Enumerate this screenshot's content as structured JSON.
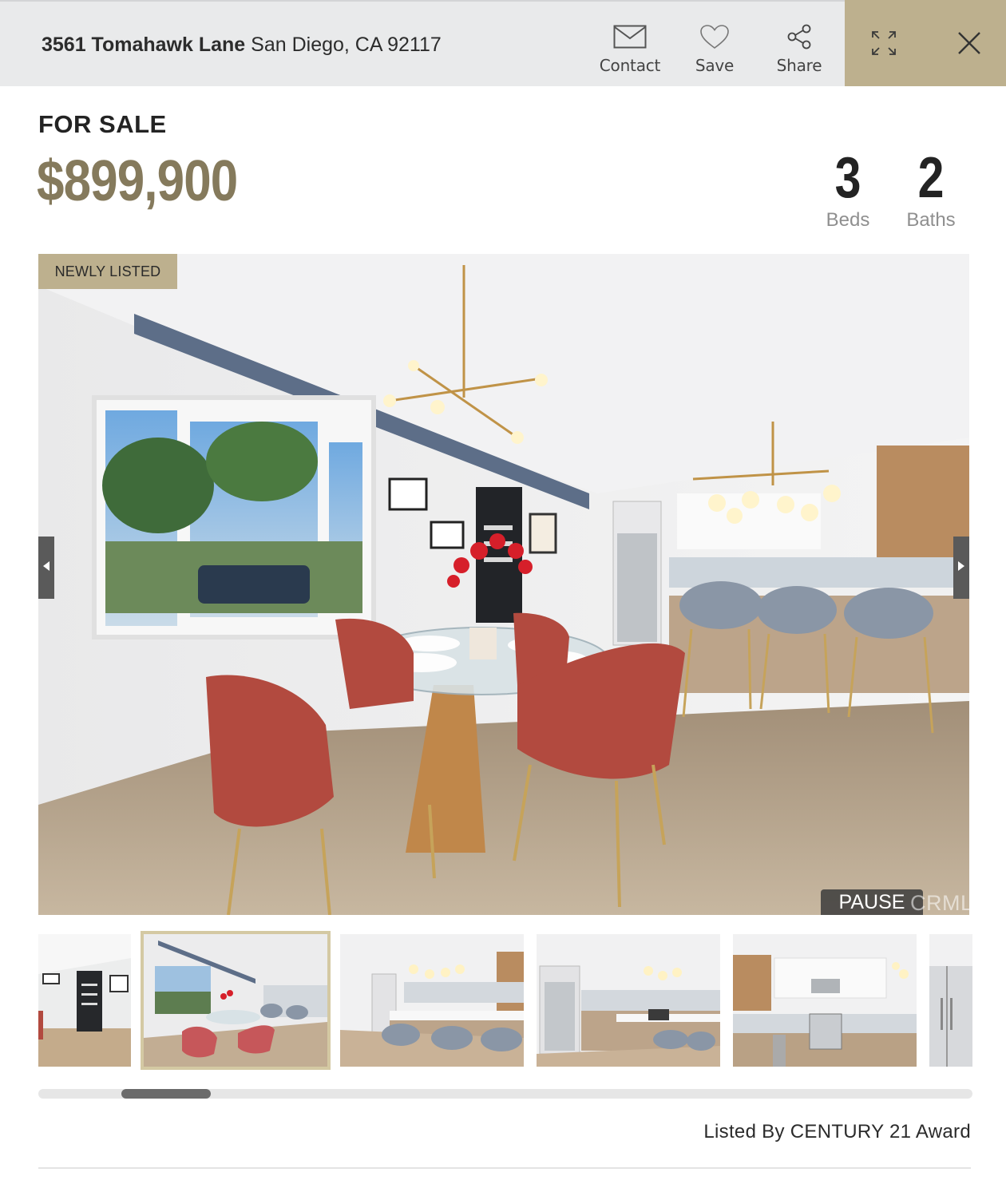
{
  "header": {
    "street": "3561 Tomahawk Lane",
    "city_line": "San Diego, CA 92117",
    "actions": [
      {
        "label": "Contact",
        "icon": "envelope-icon"
      },
      {
        "label": "Save",
        "icon": "heart-icon"
      },
      {
        "label": "Share",
        "icon": "share-icon"
      }
    ],
    "expand_icon": "expand-icon",
    "close_icon": "close-icon"
  },
  "listing": {
    "status": "FOR SALE",
    "price": "$899,900",
    "beds": {
      "value": "3",
      "label": "Beds"
    },
    "baths": {
      "value": "2",
      "label": "Baths"
    }
  },
  "gallery": {
    "badge": "NEWLY LISTED",
    "pause_label": "PAUSE",
    "watermark": "CRMLS",
    "thumbnails": [
      {
        "subject": "living room with black front door"
      },
      {
        "subject": "dining area with red chairs",
        "active": true
      },
      {
        "subject": "kitchen island with stools"
      },
      {
        "subject": "kitchen with refrigerator"
      },
      {
        "subject": "kitchen with range and cabinets"
      },
      {
        "subject": "refrigerator"
      }
    ]
  },
  "footer": {
    "listed_by": "Listed By CENTURY 21 Award"
  },
  "colors": {
    "accent": "#bdb08e",
    "price": "#857a5c",
    "header_bg": "#e9eaeb"
  }
}
